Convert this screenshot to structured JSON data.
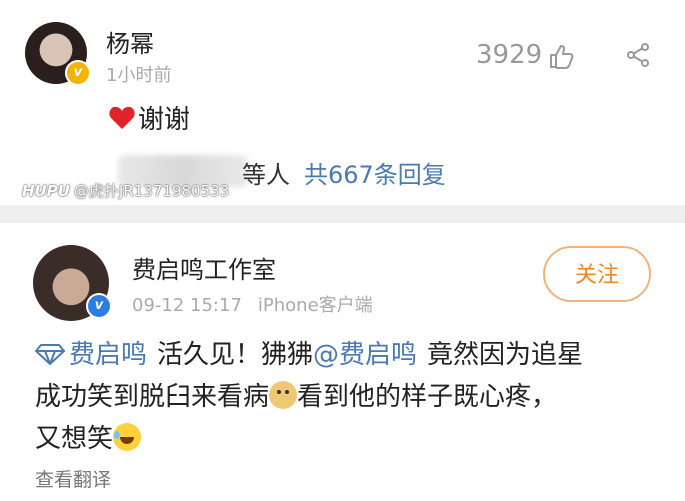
{
  "reply": {
    "user_name": "杨幂",
    "time_ago": "1小时前",
    "like_count": "3929",
    "text": "谢谢",
    "others_label": "等人",
    "reply_count_link": "共667条回复",
    "icons": [
      "heart-icon",
      "like-icon",
      "share-icon",
      "verified-badge-icon"
    ]
  },
  "watermark": {
    "logo": "HUPU",
    "text": "@虎扑JR1371980533"
  },
  "post": {
    "user_name": "费启鸣工作室",
    "date": "09-12 15:17",
    "client": "iPhone客户端",
    "follow_label": "关注",
    "super_topic": "费启鸣",
    "line1_text": "活久见！狒狒",
    "mention": "@费启鸣",
    "line1_rest": "竟然因为追星",
    "line2_text": "成功笑到脱臼来看病",
    "line2_rest": "看到他的样子既心疼，",
    "line3_text": "又想笑",
    "translate_label": "查看翻译",
    "icons": [
      "diamond-icon",
      "dog-emoji-icon",
      "laugh-cry-emoji-icon",
      "verified-badge-icon"
    ]
  },
  "colors": {
    "link_blue": "#4b7ab3",
    "follow_orange": "#ea8a2d",
    "gold_badge": "#f1b400",
    "blue_badge": "#2f7de1"
  }
}
